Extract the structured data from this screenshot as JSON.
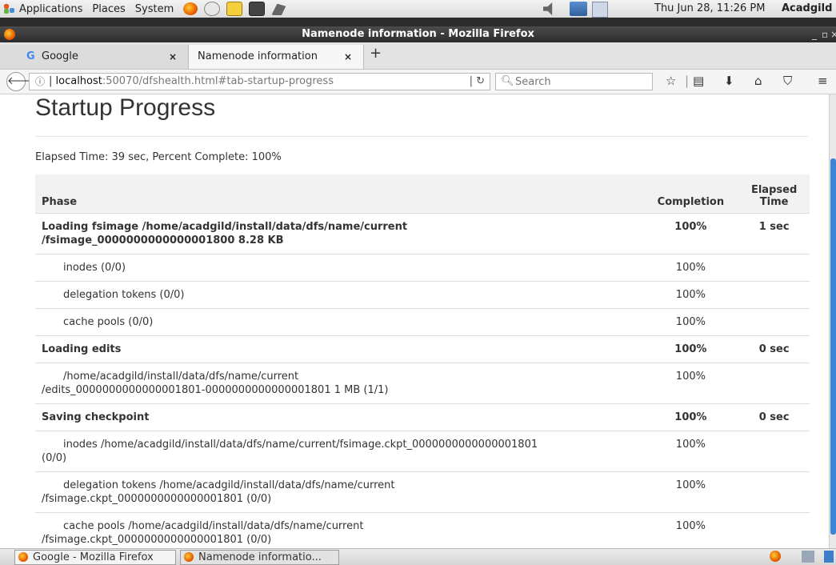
{
  "panel": {
    "menus": [
      "Applications",
      "Places",
      "System"
    ],
    "clock": "Thu Jun 28, 11:26 PM",
    "user": "Acadgild"
  },
  "window": {
    "title": "Namenode information - Mozilla Firefox",
    "minimize": "_",
    "maximize": "▫",
    "close": "×"
  },
  "tabs": [
    {
      "label": "Google",
      "favicon": "G",
      "close": "×"
    },
    {
      "label": "Namenode information",
      "close": "×"
    }
  ],
  "newtab": "+",
  "navbar": {
    "url_host": "localhost",
    "url_rest": ":50070/dfshealth.html#tab-startup-progress",
    "search_placeholder": "Search"
  },
  "page": {
    "title": "Startup Progress",
    "summary": "Elapsed Time: 39 sec, Percent Complete: 100%",
    "headers": {
      "phase": "Phase",
      "completion": "Completion",
      "elapsed1": "Elapsed",
      "elapsed2": "Time"
    },
    "rows": [
      {
        "phase1": "Loading fsimage /home/acadgild/install/data/dfs/name/current",
        "phase2": "/fsimage_0000000000000001800 8.28 KB",
        "completion": "100%",
        "elapsed": "1 sec"
      },
      {
        "phase1": "inodes (0/0)",
        "completion": "100%",
        "elapsed": ""
      },
      {
        "phase1": "delegation tokens (0/0)",
        "completion": "100%",
        "elapsed": ""
      },
      {
        "phase1": "cache pools (0/0)",
        "completion": "100%",
        "elapsed": ""
      },
      {
        "phase1": "Loading edits",
        "completion": "100%",
        "elapsed": "0 sec"
      },
      {
        "phase1": "/home/acadgild/install/data/dfs/name/current",
        "phase2": "/edits_0000000000000001801-0000000000000001801 1 MB (1/1)",
        "completion": "100%",
        "elapsed": ""
      },
      {
        "phase1": "Saving checkpoint",
        "completion": "100%",
        "elapsed": "0 sec"
      },
      {
        "phase1": "inodes /home/acadgild/install/data/dfs/name/current/fsimage.ckpt_0000000000000001801",
        "phase2": "(0/0)",
        "completion": "100%",
        "elapsed": ""
      },
      {
        "phase1": "delegation tokens /home/acadgild/install/data/dfs/name/current",
        "phase2": "/fsimage.ckpt_0000000000000001801 (0/0)",
        "completion": "100%",
        "elapsed": ""
      },
      {
        "phase1": "cache pools /home/acadgild/install/data/dfs/name/current",
        "phase2": "/fsimage.ckpt_0000000000000001801 (0/0)",
        "completion": "100%",
        "elapsed": ""
      }
    ]
  },
  "taskbar": {
    "items": [
      "Google - Mozilla Firefox",
      "Namenode informatio..."
    ]
  }
}
